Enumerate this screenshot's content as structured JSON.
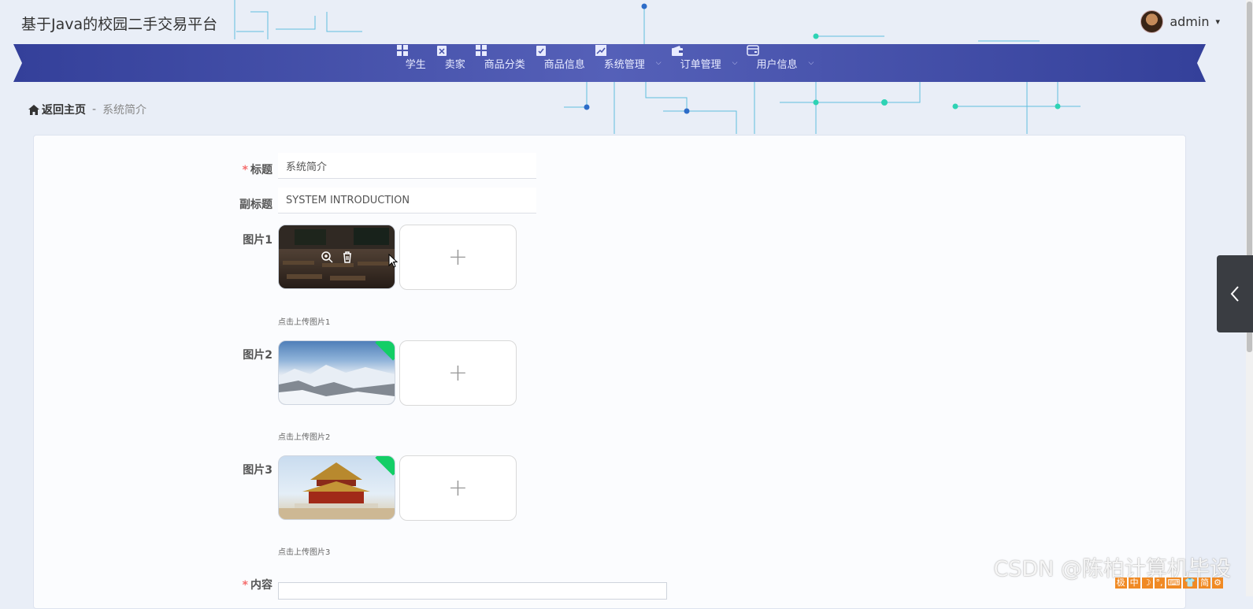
{
  "app": {
    "title": "基于Java的校园二手交易平台"
  },
  "user": {
    "name": "admin",
    "caret": "▾"
  },
  "nav": {
    "items": [
      {
        "label": "学生",
        "icon": "grid-icon",
        "has_caret": false
      },
      {
        "label": "卖家",
        "icon": "clipboard-x-icon",
        "has_caret": false
      },
      {
        "label": "商品分类",
        "icon": "grid-icon",
        "has_caret": false
      },
      {
        "label": "商品信息",
        "icon": "clipboard-check-icon",
        "has_caret": false
      },
      {
        "label": "系统管理",
        "icon": "chart-icon",
        "has_caret": true
      },
      {
        "label": "订单管理",
        "icon": "wallet-icon",
        "has_caret": true
      },
      {
        "label": "用户信息",
        "icon": "card-icon",
        "has_caret": true
      }
    ],
    "caret": "⌵"
  },
  "breadcrumb": {
    "home": "返回主页",
    "separator": "-",
    "current": "系统简介"
  },
  "form": {
    "title": {
      "label": "标题",
      "required_mark": "*",
      "value": "系统简介"
    },
    "subtitle": {
      "label": "副标题",
      "value": "SYSTEM INTRODUCTION"
    },
    "picture1": {
      "label": "图片1",
      "hint": "点击上传图片1",
      "plus": "+"
    },
    "picture2": {
      "label": "图片2",
      "hint": "点击上传图片2",
      "plus": "+"
    },
    "picture3": {
      "label": "图片3",
      "hint": "点击上传图片3",
      "plus": "+"
    },
    "content": {
      "label": "内容",
      "required_mark": "*"
    }
  },
  "watermark": "CSDN @陈柏计算机毕设",
  "ime": [
    "极",
    "中",
    "☽",
    "°,",
    "⌨",
    "👕",
    "简",
    "⚙"
  ],
  "colors": {
    "nav_bg": "#3f4aa6",
    "required": "#f56c6c",
    "badge": "#13ce66"
  }
}
